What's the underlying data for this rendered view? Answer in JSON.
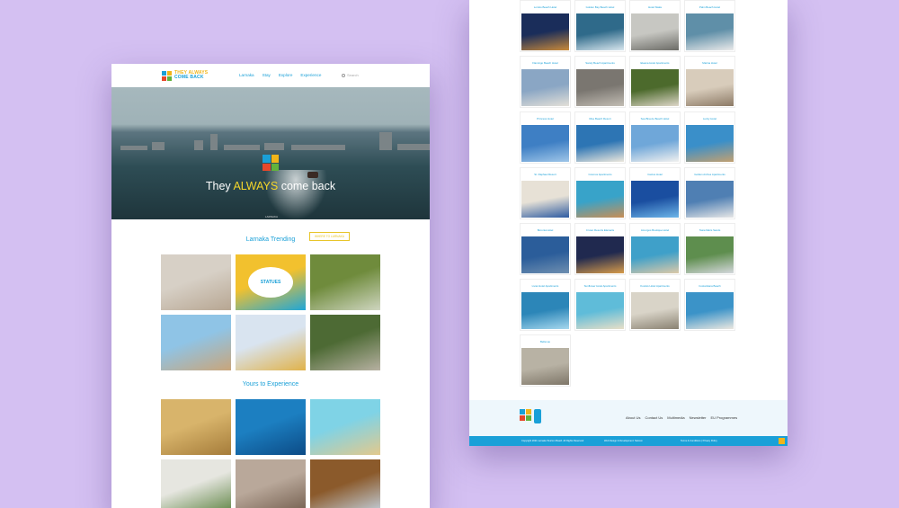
{
  "brand": {
    "logo_line1": "THEY ALWAYS",
    "logo_line2": "COME BACK"
  },
  "nav": [
    "Larnaka",
    "Stay",
    "Explore",
    "Experience"
  ],
  "search_placeholder": "Search",
  "hero": {
    "title_pre": "They ",
    "title_accent": "ALWAYS",
    "title_post": " come back",
    "small_text": "LARNAKA",
    "button": "WHERE TO LARNAKA"
  },
  "sections": {
    "trending": "Larnaka Trending",
    "experience": "Yours to Experience"
  },
  "trending_tiles": [
    {
      "name": "lace",
      "colors": [
        "#d7d0c6",
        "#b7a692"
      ]
    },
    {
      "name": "statues",
      "colors": [
        "#f2c12e",
        "#1fa6d8"
      ],
      "text": "STATUES"
    },
    {
      "name": "beekeepers",
      "colors": [
        "#6f8b3c",
        "#cfd6c0"
      ]
    },
    {
      "name": "old-house",
      "colors": [
        "#8fc4e6",
        "#c9a57a"
      ]
    },
    {
      "name": "beach-umbrellas",
      "colors": [
        "#d9e4f0",
        "#e0b24a"
      ]
    },
    {
      "name": "alley-garden",
      "colors": [
        "#4d6a34",
        "#b7b1a2"
      ]
    }
  ],
  "experience_tiles": [
    {
      "name": "baskets",
      "colors": [
        "#d8b46b",
        "#a57c3a"
      ]
    },
    {
      "name": "diving",
      "colors": [
        "#1c7fc1",
        "#0c4b86"
      ]
    },
    {
      "name": "beach-aerial",
      "colors": [
        "#7fd3e6",
        "#e3c98c"
      ]
    },
    {
      "name": "village-lane",
      "colors": [
        "#e6e6e0",
        "#59803d"
      ]
    },
    {
      "name": "pottery",
      "colors": [
        "#b9a89a",
        "#6f5a4a"
      ]
    },
    {
      "name": "taverna",
      "colors": [
        "#8b5a2b",
        "#c6d8e8"
      ]
    }
  ],
  "hotels": [
    {
      "name": "Lordos Beach Hotel",
      "colors": [
        "#1a2d5a",
        "#c98a3a"
      ]
    },
    {
      "name": "Golden Bay Beach Hotel",
      "colors": [
        "#2f6a8a",
        "#d8e6ee"
      ]
    },
    {
      "name": "Hotel Skala",
      "colors": [
        "#c7c7c2",
        "#6b6b66"
      ]
    },
    {
      "name": "Palm Beach Hotel",
      "colors": [
        "#5f8fa8",
        "#eaeaea"
      ]
    },
    {
      "name": "Flamingo Beach Hotel",
      "colors": [
        "#8aa6c4",
        "#e3e0d8"
      ]
    },
    {
      "name": "Sandy Beach Apartments",
      "colors": [
        "#7a7670",
        "#c2bdb4"
      ]
    },
    {
      "name": "Eleana Hotel Apartments",
      "colors": [
        "#4c6a2c",
        "#ddd6c8"
      ]
    },
    {
      "name": "Marina Hotel",
      "colors": [
        "#d8ccbb",
        "#8c7a66"
      ]
    },
    {
      "name": "Princess Hotel",
      "colors": [
        "#3e7fc4",
        "#9fc6e8"
      ]
    },
    {
      "name": "Rise Beach Resort",
      "colors": [
        "#2d75b4",
        "#ede8dd"
      ]
    },
    {
      "name": "Sea Breeze Beach Hotel",
      "colors": [
        "#6fa7d9",
        "#f1f1ef"
      ]
    },
    {
      "name": "Lucky Hotel",
      "colors": [
        "#3a8fc9",
        "#c2a071"
      ]
    },
    {
      "name": "St. Raphael Resort",
      "colors": [
        "#e7e1d6",
        "#2d5aa0"
      ]
    },
    {
      "name": "Cosmos Apartments",
      "colors": [
        "#38a3c9",
        "#c98e54"
      ]
    },
    {
      "name": "Cactus Hotel",
      "colors": [
        "#1a4ea0",
        "#6cb4e8"
      ]
    },
    {
      "name": "Golden Arches Apartments",
      "colors": [
        "#4f7fb3",
        "#e6e6e6"
      ]
    },
    {
      "name": "Boronia Hotel",
      "colors": [
        "#2b5d9a",
        "#6f8fb0"
      ]
    },
    {
      "name": "Crown Resorts Elamaris",
      "colors": [
        "#20294f",
        "#d79b4a"
      ]
    },
    {
      "name": "Amorgos Boutique Hotel",
      "colors": [
        "#3fa0c9",
        "#dcc9a8"
      ]
    },
    {
      "name": "Tasia Maris Sands",
      "colors": [
        "#5e8e4e",
        "#d4d8dc"
      ]
    },
    {
      "name": "Livas Hotel Apartments",
      "colors": [
        "#2c86b8",
        "#a6d8ee"
      ]
    },
    {
      "name": "Sunflower Hotel Apartments",
      "colors": [
        "#5fbcd9",
        "#e8dfc8"
      ]
    },
    {
      "name": "Koutsis Hotel Apartments",
      "colors": [
        "#d9d4c8",
        "#8a8272"
      ]
    },
    {
      "name": "Costantiana Beach",
      "colors": [
        "#3b93c8",
        "#ece8e0"
      ]
    },
    {
      "name": "Bellevue",
      "colors": [
        "#b8b2a4",
        "#7e7668"
      ]
    }
  ],
  "footer": {
    "links": [
      "About Us",
      "Contact Us",
      "Multimedia",
      "Newsletter",
      "EU Programmes"
    ],
    "copyright": "Copyright 2021 Larnaka Tourism Board. All Rights Reserved",
    "credit": "Web Design & Development: Netcom",
    "legal": "Terms & Conditions | Privacy Policy"
  },
  "colors": {
    "accent_blue": "#1aa0d8",
    "accent_yellow": "#f5d62a",
    "backdrop": "#d4c0f2"
  }
}
